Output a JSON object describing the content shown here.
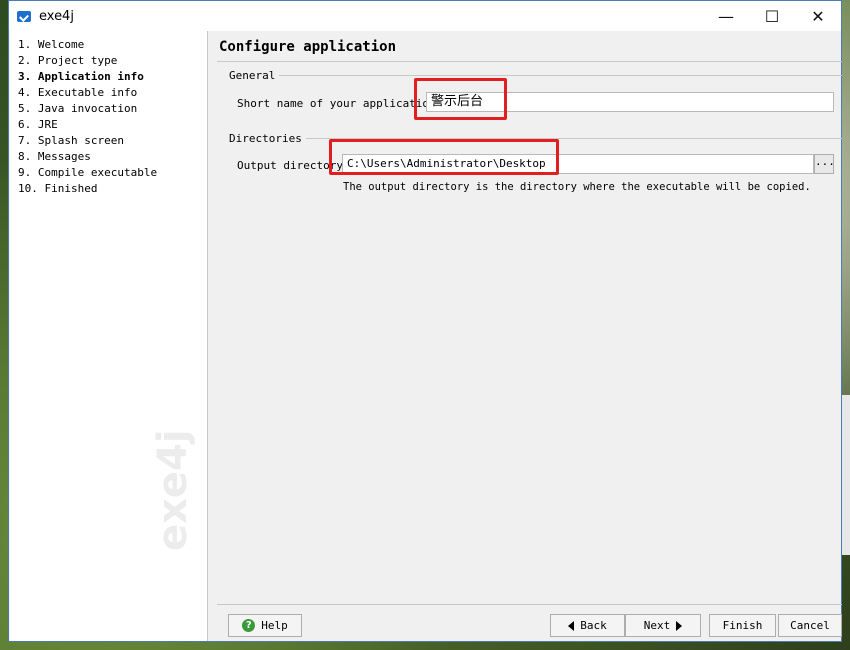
{
  "window": {
    "title": "exe4j",
    "controls": {
      "minimize": "—",
      "maximize": "☐",
      "close": "✕"
    }
  },
  "sidebar": {
    "steps": [
      "1. Welcome",
      "2. Project type",
      "3. Application info",
      "4. Executable info",
      "5. Java invocation",
      "6. JRE",
      "7. Splash screen",
      "8. Messages",
      "9. Compile executable",
      "10. Finished"
    ],
    "active_index": 2,
    "watermark": "exe4j"
  },
  "main": {
    "heading": "Configure application",
    "general": {
      "label": "General",
      "short_name_label": "Short name of your application:",
      "short_name_value": "警示后台"
    },
    "directories": {
      "label": "Directories",
      "output_label": "Output directory:",
      "output_value": "C:\\Users\\Administrator\\Desktop",
      "browse_label": "...",
      "hint": "The output directory is the directory where the executable will be copied."
    }
  },
  "buttons": {
    "help": "Help",
    "back": "Back",
    "next": "Next",
    "finish": "Finish",
    "cancel": "Cancel"
  },
  "colors": {
    "highlight_box": "#e41e1e",
    "window_border": "#4a7bb5",
    "help_icon": "#3a9a3a"
  },
  "icons": {
    "app": "exe4j-app-icon",
    "help": "help-icon",
    "back": "arrow-left-icon",
    "next": "arrow-right-icon"
  }
}
